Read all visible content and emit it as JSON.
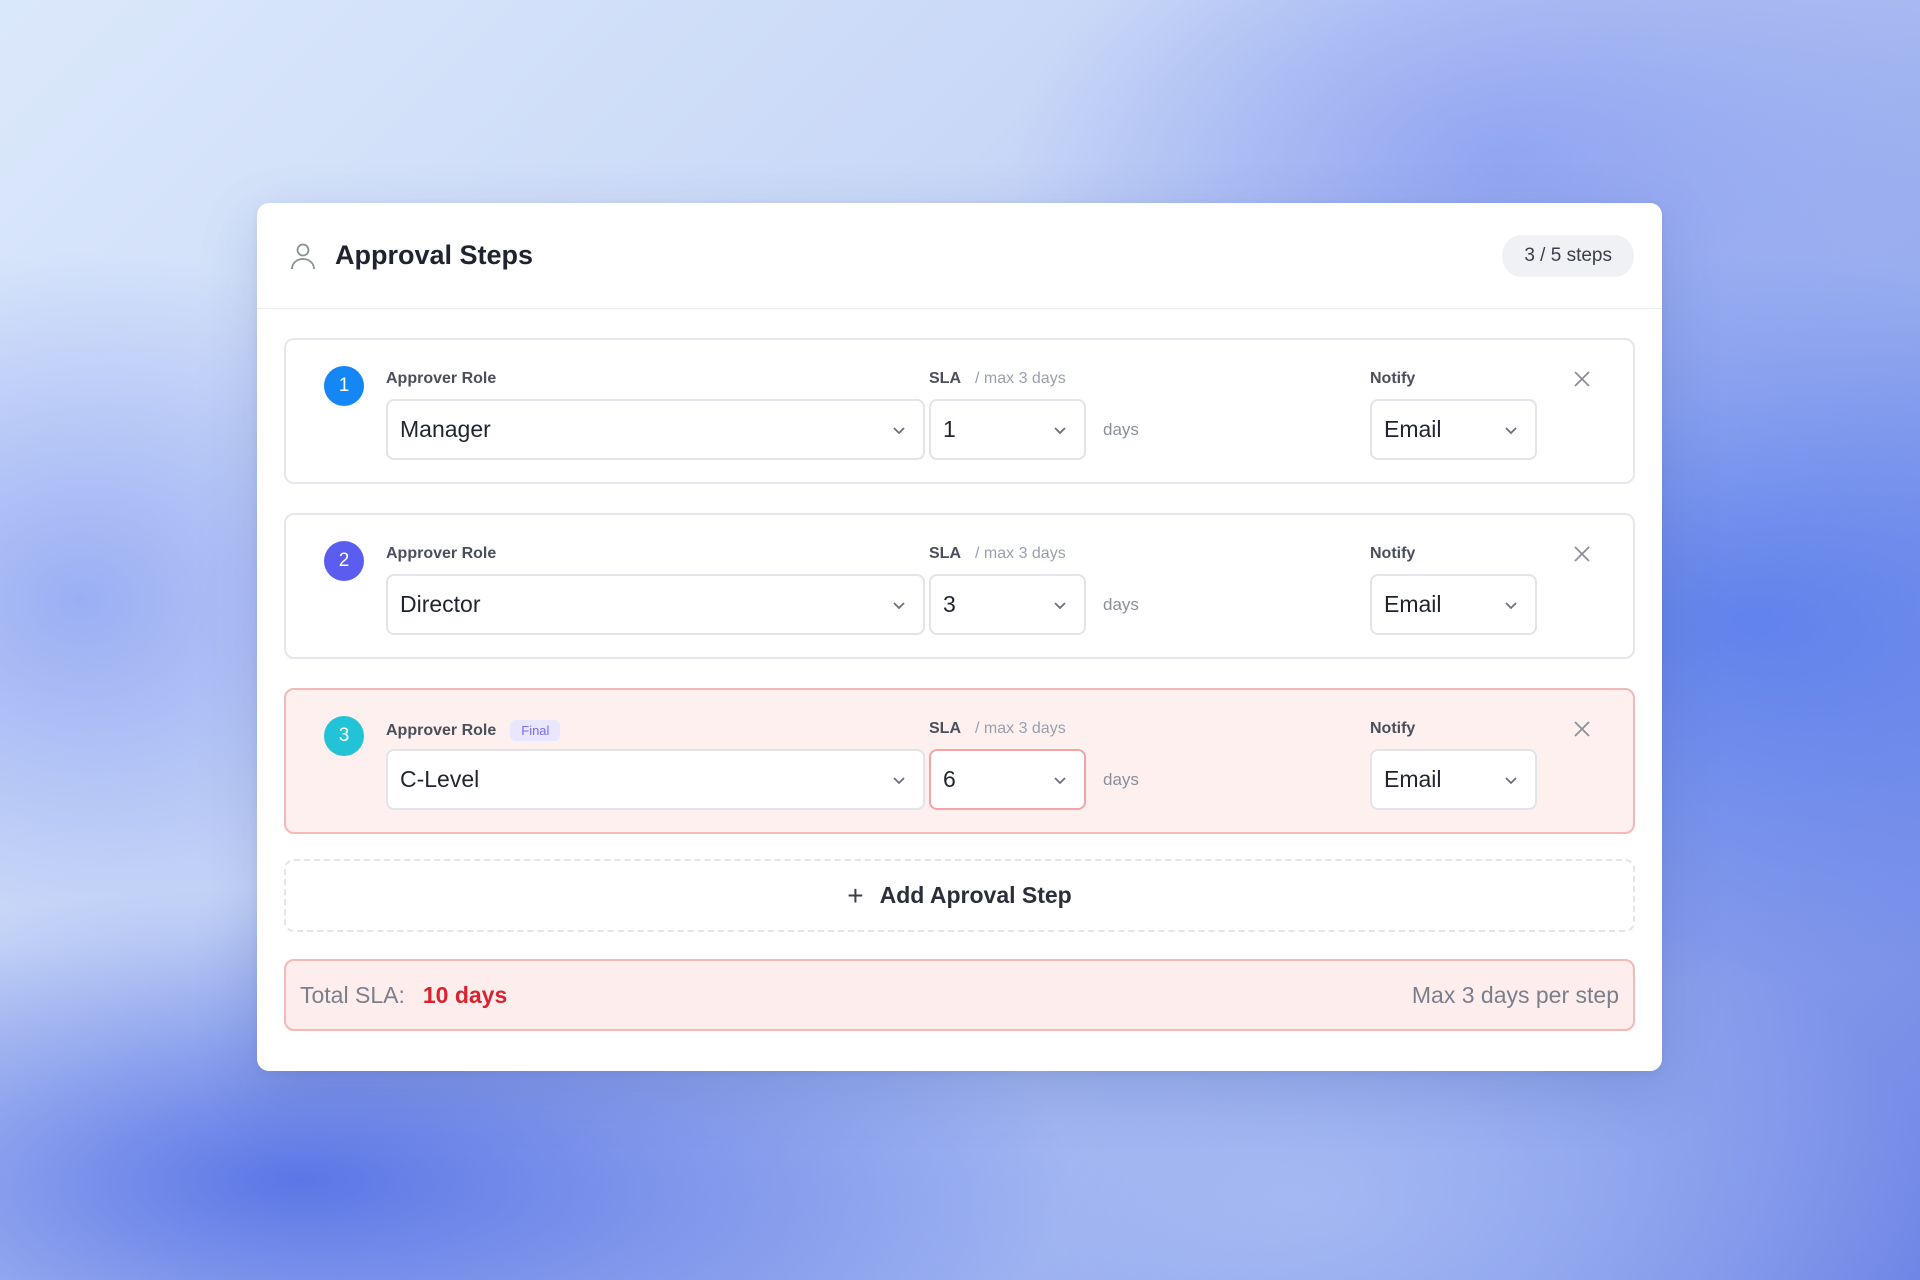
{
  "header": {
    "title": "Approval Steps",
    "step_count": "3 / 5 steps",
    "icon": "user-icon"
  },
  "labels": {
    "approver_role": "Approver Role",
    "sla": "SLA",
    "sla_hint": "/ max 3 days",
    "notify": "Notify",
    "days_unit": "days",
    "final_tag": "Final"
  },
  "steps": [
    {
      "number": "1",
      "role": "Manager",
      "sla": "1",
      "notify": "Email",
      "badge_color": "#1486f5",
      "error": false,
      "final": false
    },
    {
      "number": "2",
      "role": "Director",
      "sla": "3",
      "notify": "Email",
      "badge_color": "#5b5cf0",
      "error": false,
      "final": false
    },
    {
      "number": "3",
      "role": "C-Level",
      "sla": "6",
      "notify": "Email",
      "badge_color": "#22c3d6",
      "error": true,
      "final": true
    }
  ],
  "add_step": {
    "label": "Add Aproval Step",
    "icon": "plus-icon"
  },
  "summary": {
    "label": "Total SLA:",
    "value": "10 days",
    "note": "Max 3 days per step"
  },
  "colors": {
    "error_text": "#d9232f",
    "error_bg": "#fdeeed",
    "error_border": "#f4b8b6"
  }
}
